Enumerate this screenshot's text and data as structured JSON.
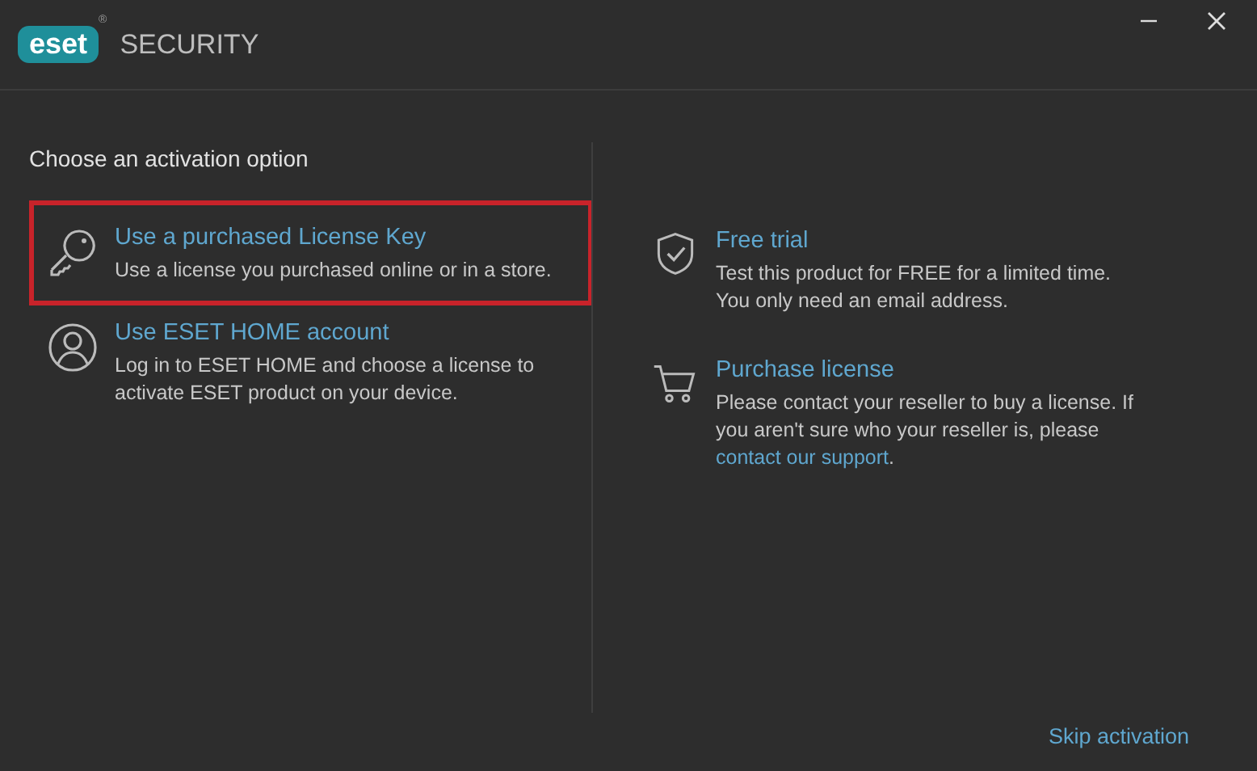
{
  "header": {
    "logo": "eset",
    "logo_mark": "®",
    "title": "SECURITY",
    "controls": [
      {
        "kind": "minimize"
      },
      {
        "kind": "close"
      }
    ]
  },
  "heading": "Choose an activation option",
  "left_options": [
    {
      "kind": "key",
      "title": "Use a purchased License Key",
      "description": "Use a license you purchased online or in a store.",
      "selected": true
    },
    {
      "kind": "person",
      "title": "Use ESET HOME account",
      "description": "Log in to ESET HOME and choose a license to activate ESET product on your device.",
      "selected": false
    }
  ],
  "right_options": [
    {
      "kind": "shield",
      "title": "Free trial",
      "description": "Test this product for FREE for a limited time. You only need an email address.",
      "selected": false
    },
    {
      "kind": "cart",
      "title": "Purchase license",
      "description": "Please contact your reseller to buy a license. If you aren't sure who your reseller is, please",
      "link": "contact our support",
      "link_suffix": ".",
      "selected": false
    }
  ],
  "skip_link": "Skip activation"
}
